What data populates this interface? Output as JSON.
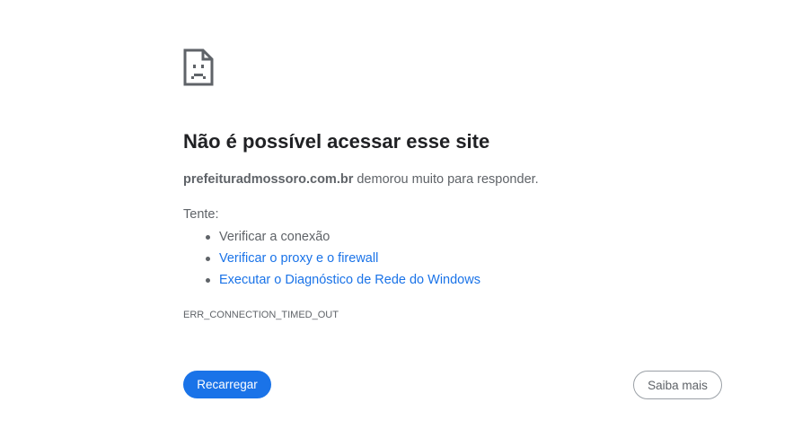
{
  "error": {
    "icon": "sad-page-icon",
    "title": "Não é possível acessar esse site",
    "host": "prefeituradmossoro.com.br",
    "summary_suffix": " demorou muito para responder.",
    "try_label": "Tente:",
    "suggestions": [
      {
        "label": "Verificar a conexão",
        "is_link": false
      },
      {
        "label": "Verificar o proxy e o firewall",
        "is_link": true
      },
      {
        "label": "Executar o Diagnóstico de Rede do Windows",
        "is_link": true
      }
    ],
    "code": "ERR_CONNECTION_TIMED_OUT"
  },
  "buttons": {
    "reload_label": "Recarregar",
    "details_label": "Saiba mais"
  },
  "colors": {
    "accent": "#1a73e8",
    "title_text": "#202124",
    "body_text": "#5f6368",
    "background": "#ffffff"
  }
}
